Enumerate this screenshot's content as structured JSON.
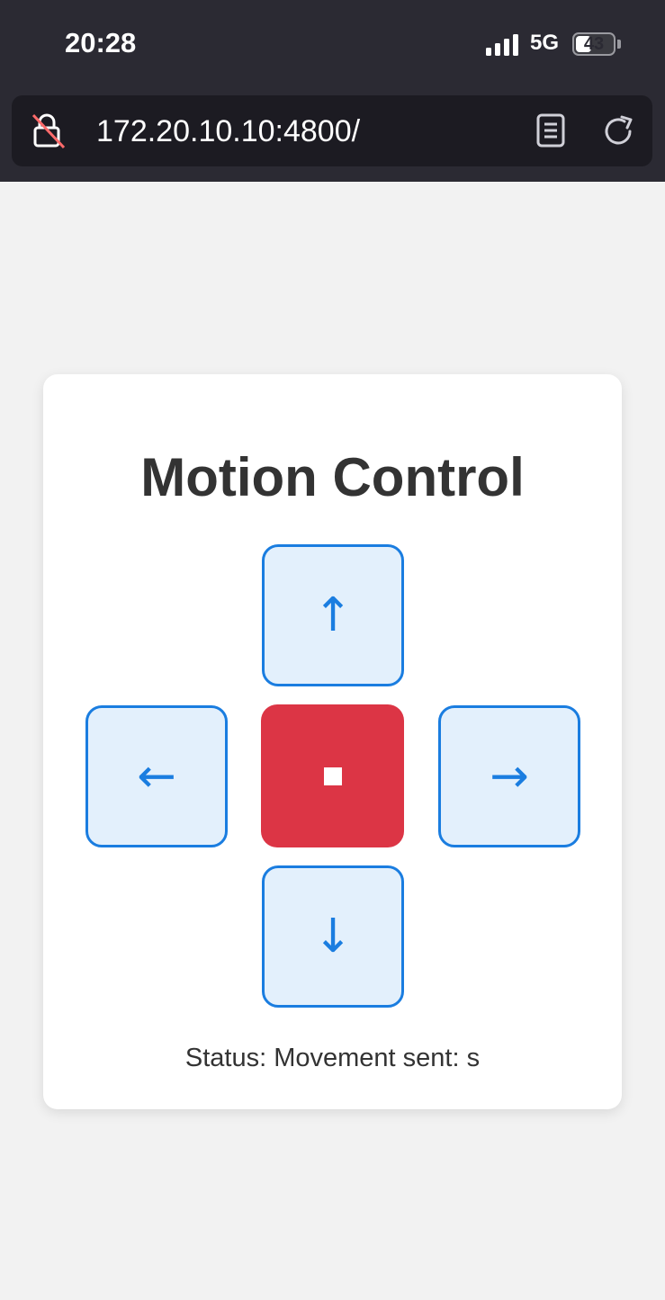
{
  "status_bar": {
    "time": "20:28",
    "network": "5G",
    "battery_level": "43",
    "battery_fraction": 0.43
  },
  "browser": {
    "url": "172.20.10.10:4800/",
    "icons": [
      "lock-slash-icon",
      "reader-mode-icon",
      "reload-icon"
    ]
  },
  "page": {
    "title": "Motion Control",
    "controls": {
      "up": "↑",
      "left": "←",
      "stop": "■",
      "right": "→",
      "down": "↓"
    },
    "status_text": "Status: Movement sent: s"
  },
  "colors": {
    "accent": "#1a7de0",
    "button_bg": "#e3f0fc",
    "stop": "#dc3545",
    "text": "#333333"
  }
}
